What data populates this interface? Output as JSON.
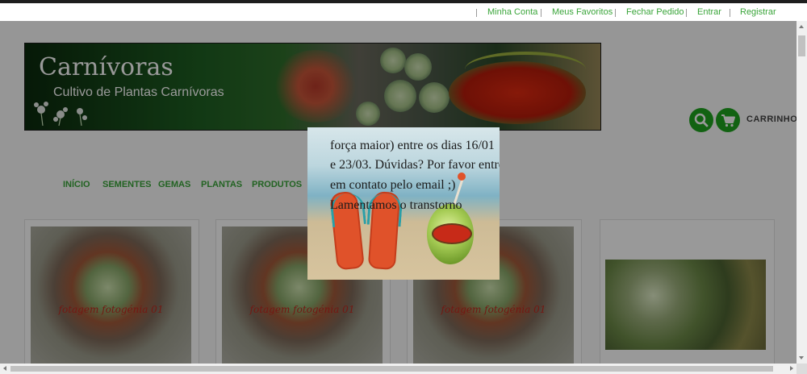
{
  "header": {
    "links": [
      {
        "label": "Minha Conta"
      },
      {
        "label": "Meus Favoritos"
      },
      {
        "label": "Fechar Pedido"
      },
      {
        "label": "Entrar"
      },
      {
        "label": "Registrar"
      }
    ]
  },
  "banner": {
    "title": "Carnívoras",
    "subtitle": "Cultivo de Plantas Carnívoras"
  },
  "actions": {
    "search_icon": "search-icon",
    "cart_icon": "cart-icon",
    "cart_label": "CARRINHO"
  },
  "nav": {
    "items": [
      {
        "label": "INÍCIO"
      },
      {
        "label": "SEMENTES"
      },
      {
        "label": "GEMAS"
      },
      {
        "label": "PLANTAS"
      },
      {
        "label": "PRODUTOS"
      }
    ]
  },
  "products": [
    {
      "caption": "fotagem fotogénia 01"
    },
    {
      "caption": "fotagem fotogénia 01"
    },
    {
      "caption": "fotagem fotogénia 01"
    },
    {
      "caption": ""
    }
  ],
  "popup": {
    "lines": [
      "força maior) entre os dias 16/01",
      "e 23/03. Dúvidas? Por favor entre",
      "em contato pelo email ;)",
      "  Lamentamos o transtorno"
    ]
  },
  "colors": {
    "accent": "#1ea31e",
    "link": "#3aa53a",
    "overlay": "rgba(0,0,0,0.4)"
  }
}
